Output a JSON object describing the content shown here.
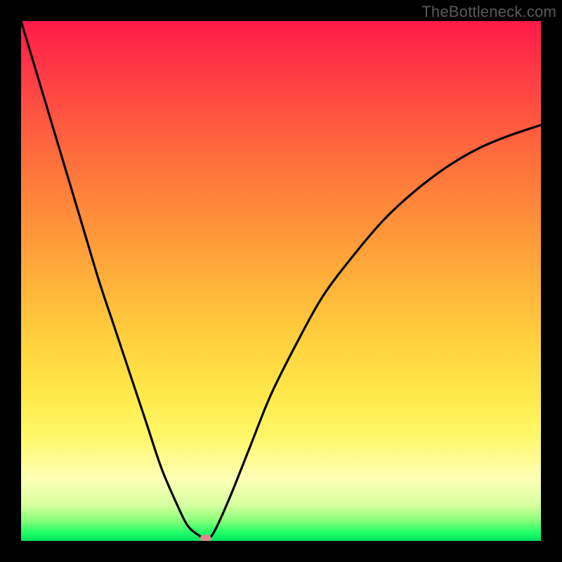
{
  "watermark": "TheBottleneck.com",
  "chart_data": {
    "type": "line",
    "title": "",
    "xlabel": "",
    "ylabel": "",
    "xlim": [
      0,
      100
    ],
    "ylim": [
      0,
      100
    ],
    "series": [
      {
        "name": "bottleneck-curve",
        "x": [
          0,
          3,
          6,
          9,
          12,
          15,
          18,
          21,
          24,
          27,
          30,
          32,
          34,
          35.5,
          37,
          40,
          44,
          48,
          53,
          58,
          64,
          70,
          76,
          82,
          88,
          94,
          100
        ],
        "y": [
          100,
          90,
          80,
          70,
          60,
          50,
          41,
          32,
          23,
          14,
          7,
          3,
          1.2,
          0.5,
          1.5,
          8,
          18,
          28,
          38,
          47,
          55,
          62,
          67.5,
          72,
          75.5,
          78,
          80
        ]
      }
    ],
    "marker": {
      "x": 35.5,
      "y": 0.5,
      "color": "#d88a8a"
    },
    "background_gradient": {
      "top": "#ff1a49",
      "bottom": "#00e05b"
    }
  }
}
